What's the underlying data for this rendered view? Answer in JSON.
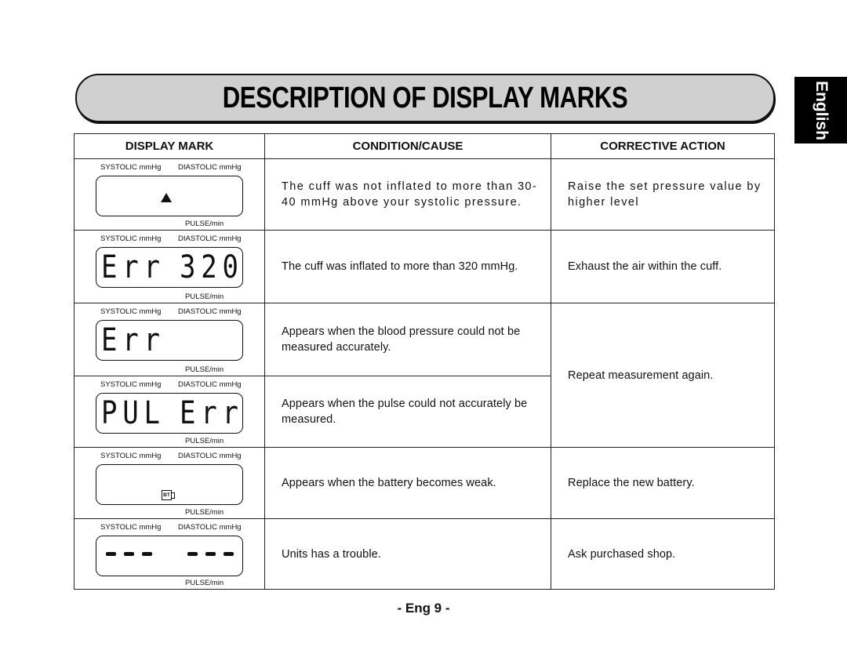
{
  "page": {
    "title": "DESCRIPTION OF DISPLAY MARKS",
    "language_tab": "English",
    "footer": "- Eng 9 -"
  },
  "table": {
    "headers": [
      "DISPLAY MARK",
      "CONDITION/CAUSE",
      "CORRECTIVE ACTION"
    ],
    "lcd_labels": {
      "systolic": "SYSTOLIC mmHg",
      "diastolic": "DIASTOLIC mmHg",
      "pulse": "PULSE/min"
    },
    "rows": [
      {
        "display": {
          "type": "triangle-icon",
          "left": "",
          "right": ""
        },
        "condition": "The cuff was not inflated to more than 30-40 mmHg above your systolic pressure.",
        "action": "Raise the set pressure value by higher level"
      },
      {
        "display": {
          "type": "segment",
          "left": "Err",
          "right": "320"
        },
        "condition": "The cuff was inflated to more than 320 mmHg.",
        "action": "Exhaust the air within the cuff."
      },
      {
        "display": {
          "type": "segment",
          "left": "Err",
          "right": ""
        },
        "condition": "Appears when the blood pressure could not be measured accurately.",
        "action": "Repeat measurement again."
      },
      {
        "display": {
          "type": "segment",
          "left": "PUL",
          "right": "Err"
        },
        "condition": "Appears when the pulse could not accurately be measured.",
        "action": "Repeat measurement again."
      },
      {
        "display": {
          "type": "battery-icon",
          "icon_text": "BT"
        },
        "condition": "Appears when the battery becomes weak.",
        "action": "Replace the new battery."
      },
      {
        "display": {
          "type": "dashes",
          "left": "---",
          "right": "---"
        },
        "condition": "Units has a trouble.",
        "action": "Ask purchased shop."
      }
    ]
  }
}
